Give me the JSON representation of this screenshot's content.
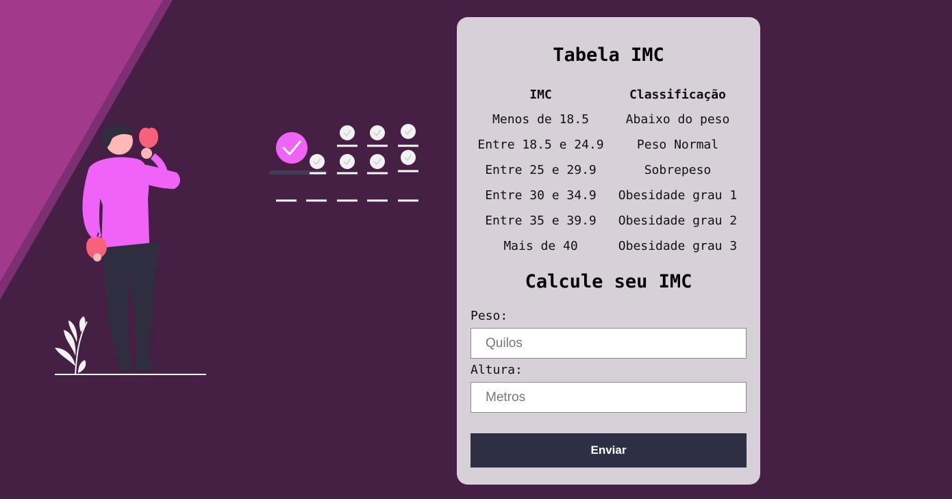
{
  "table": {
    "title": "Tabela IMC",
    "headers": [
      "IMC",
      "Classificação"
    ],
    "rows": [
      [
        "Menos de 18.5",
        "Abaixo do peso"
      ],
      [
        "Entre 18.5 e 24.9",
        "Peso Normal"
      ],
      [
        "Entre 25 e 29.9",
        "Sobrepeso"
      ],
      [
        "Entre 30 e 34.9",
        "Obesidade grau 1"
      ],
      [
        "Entre 35 e 39.9",
        "Obesidade grau 2"
      ],
      [
        "Mais de 40",
        "Obesidade grau 3"
      ]
    ]
  },
  "form": {
    "title": "Calcule seu IMC",
    "weight_label": "Peso:",
    "weight_placeholder": "Quilos",
    "height_label": "Altura:",
    "height_placeholder": "Metros",
    "submit_label": "Enviar"
  },
  "colors": {
    "background": "#461f44",
    "stripe": "#a2398a",
    "card": "#d7d0d8",
    "button": "#2e2f45",
    "accent": "#f063f8",
    "apple": "#f9607a"
  },
  "illustration": {
    "icons": [
      "person-eating-apple-icon",
      "checklist-progress-icon",
      "plant-icon"
    ]
  }
}
